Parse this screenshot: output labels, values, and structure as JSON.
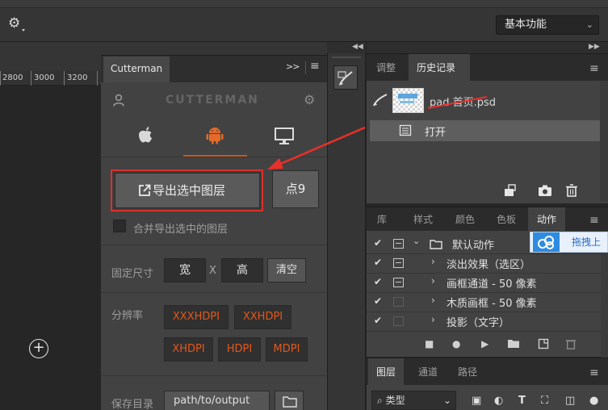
{
  "workspace": {
    "label": "基本功能"
  },
  "ruler": {
    "ticks": [
      "2800",
      "3000",
      "3200"
    ]
  },
  "cutterman": {
    "tab_label": "Cutterman",
    "expand_label": ">>",
    "title": "CUTTERMAN",
    "export_button": "导出选中图层",
    "count_button": "点9",
    "merge_label": "合并导出选中的图层",
    "fixed_size_label": "固定尺寸",
    "width_value": "宽",
    "x_label": "X",
    "height_value": "高",
    "clear_button": "清空",
    "resolution_label": "分辨率",
    "resolutions": [
      "XXXHDPI",
      "XXHDPI",
      "XHDPI",
      "HDPI",
      "MDPI"
    ],
    "save_dir_label": "保存目录",
    "save_path": "path/to/output",
    "accent_color": "#e2581c",
    "highlight_color": "#d9322b"
  },
  "history": {
    "tabs": [
      "调整",
      "历史记录"
    ],
    "active_tab": 1,
    "snapshot_name": "pad 首页.psd",
    "steps": [
      "打开"
    ]
  },
  "actions": {
    "tabs": [
      "库",
      "样式",
      "颜色",
      "色板",
      "动作"
    ],
    "active_tab": 4,
    "rows": [
      {
        "label": "默认动作",
        "checked": true,
        "dialog": true,
        "expanded": true,
        "folder": true
      },
      {
        "label": "淡出效果（选区）",
        "checked": true,
        "dialog": true
      },
      {
        "label": "画框通道 - 50 像素",
        "checked": true,
        "dialog": true
      },
      {
        "label": "木质画框 - 50 像素",
        "checked": true,
        "dialog": false
      },
      {
        "label": "投影（文字）",
        "checked": true,
        "dialog": false
      }
    ],
    "drag_tip": "拖拽上"
  },
  "layers": {
    "tabs": [
      "图层",
      "通道",
      "路径"
    ],
    "active_tab": 0,
    "filter_kind": "类型"
  }
}
